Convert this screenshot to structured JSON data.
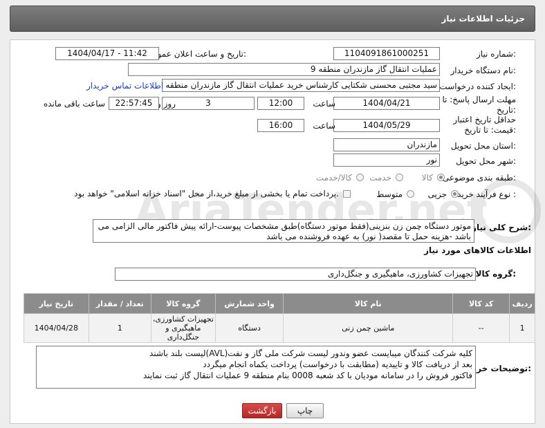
{
  "header": {
    "title": "جزئیات اطلاعات نیاز"
  },
  "form": {
    "need_number_label": "شماره نیاز:",
    "need_number": "1104091861000251",
    "announce_label": "تاریخ و ساعت اعلان عمومی:",
    "announce_value": "1404/04/17 - 11:42",
    "buyer_org_label": "نام دستگاه خریدار:",
    "buyer_org": "عملیات انتقال گاز مازندران منطقه 9",
    "requester_label": "ایجاد کننده درخواست:",
    "requester": "سید مجتبی محسنی شکتایی کارشناس خرید عملیات انتقال گاز مازندران منطقه 9",
    "contact_link": "اطلاعات تماس خریدار",
    "deadline_label": "مهلت ارسال پاسخ: تا تاریخ:",
    "deadline_date": "1404/04/21",
    "time_label": "ساعت",
    "deadline_time": "12:00",
    "days_value": "3",
    "days_label": "روز و",
    "remaining_time": "22:57:45",
    "remaining_label": "ساعت باقی مانده",
    "validity_label": "حداقل تاریخ اعتبار قیمت: تا تاریخ:",
    "validity_date": "1404/05/29",
    "validity_time": "16:00",
    "province_label": "استان محل تحویل:",
    "province": "مازندران",
    "city_label": "شهر محل تحویل:",
    "city": "نور",
    "category_label": "طبقه بندی موضوعی:",
    "category_options": [
      "کالا",
      "خدمت",
      "کالا/خدمت"
    ],
    "category_selected": "کالا",
    "process_label": "نوع فرآیند خرید :",
    "process_options": [
      "جزیی",
      "متوسط"
    ],
    "process_selected": "جزیی",
    "payment_note": "پرداخت تمام یا بخشی از مبلغ خرید،از محل \"اسناد خزانه اسلامی\" خواهد بود.",
    "general_desc_label": "شرح کلی نیاز:",
    "general_desc": "موتور دستگاه چمن زن بنزینی(فقط موتور دستگاه)طبق مشخصات پیوست-ارائه پیش فاکتور مالی  الزامی می باشد -هزینه حمل تا مقصد( نور) به عهده فروشنده می باشد"
  },
  "goods": {
    "section_title": "اطلاعات کالاهای مورد نیاز",
    "group_label": "گروه کالا:",
    "group_value": "تجهیزات کشاورزی، ماهیگیری و جنگل‌داری",
    "columns": [
      "ردیف",
      "کد کالا",
      "نام کالا",
      "واحد شمارش",
      "گروه کالا",
      "تعداد / مقدار",
      "تاریخ نیاز"
    ],
    "rows": [
      {
        "row": "1",
        "code": "--",
        "name": "ماشین چمن زنی",
        "unit": "دستگاه",
        "group": "تجهیزات کشاورزی، ماهیگیری و جنگل‌داری",
        "qty": "1",
        "date": "1404/04/28"
      }
    ]
  },
  "buyer_notes": {
    "label": "توضیحات خریدار:",
    "lines": [
      "کلیه شرکت کنندگان میبایست عضو وندور لیست شرکت ملی گاز و نفت(AVL)لیست بلند باشند",
      "بعد از دریافت کالا و تاییدیه (مطابقت با درخواست) پرداخت یکماه انجام میگردد",
      "فاکتور فروش را در سامانه مودیان با کد شعبه 0008 بنام منطقه 9 عملیات انتقال گاز ثبت نمایند"
    ]
  },
  "buttons": {
    "print": "چاپ",
    "back": "بازگشت"
  },
  "watermark": "AriaTender.net",
  "colors": {
    "link": "#1a3cc7",
    "back_button": "#c03030",
    "header_bg": "#6e6e6e",
    "table_header": "#8c8c8c"
  }
}
